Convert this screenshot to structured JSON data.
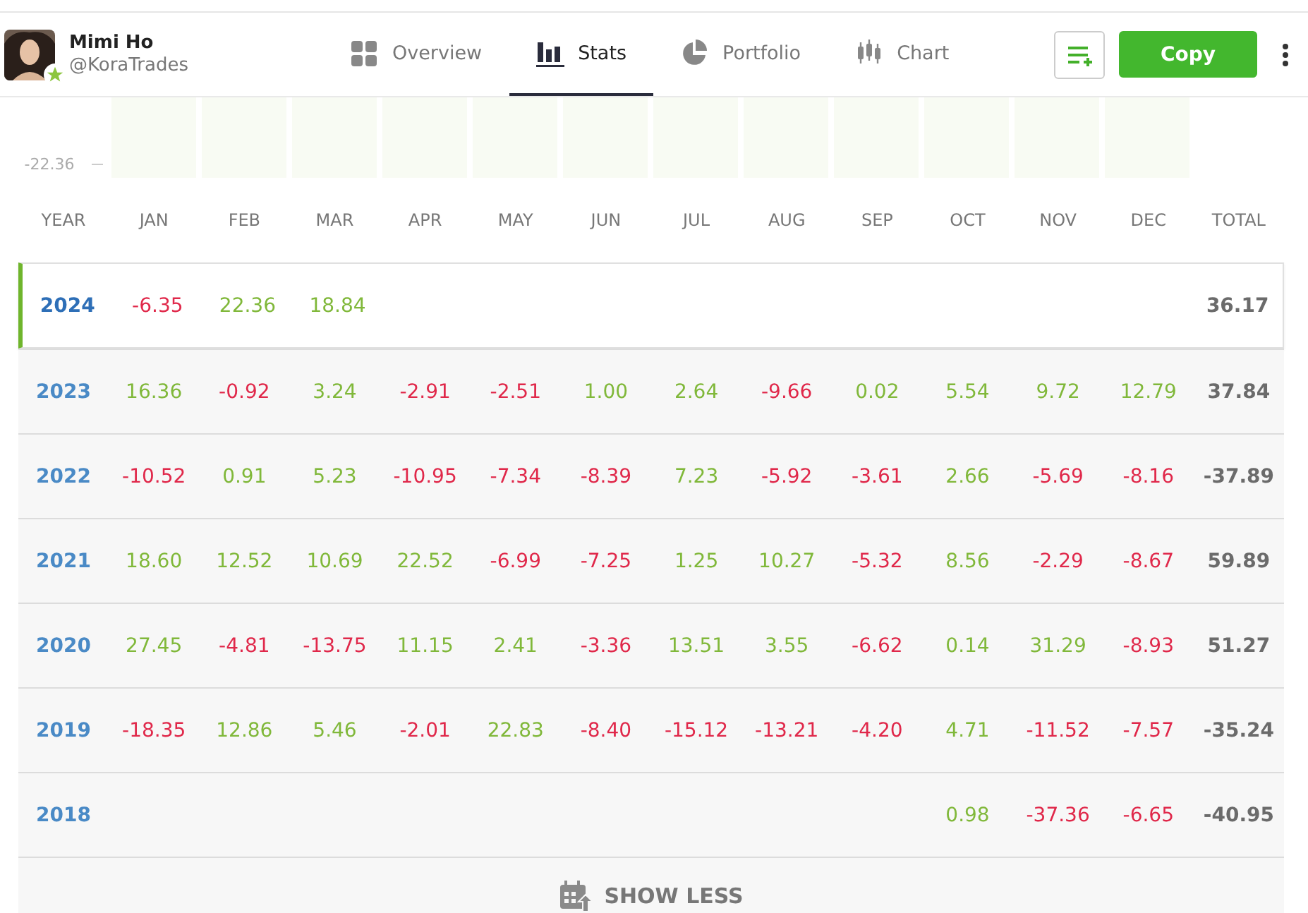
{
  "profile": {
    "name": "Mimi Ho",
    "username": "@KoraTrades"
  },
  "tabs": [
    {
      "label": "Overview",
      "selected": false
    },
    {
      "label": "Stats",
      "selected": true
    },
    {
      "label": "Portfolio",
      "selected": false
    },
    {
      "label": "Chart",
      "selected": false
    }
  ],
  "copy_button": "Copy",
  "chart": {
    "axis_label": "-22.36"
  },
  "table": {
    "columns": [
      "YEAR",
      "JAN",
      "FEB",
      "MAR",
      "APR",
      "MAY",
      "JUN",
      "JUL",
      "AUG",
      "SEP",
      "OCT",
      "NOV",
      "DEC",
      "TOTAL"
    ],
    "rows": [
      {
        "year": "2024",
        "selected": true,
        "total": "36.17",
        "months": [
          {
            "value": "-6.35",
            "kind": "loss"
          },
          {
            "value": "22.36",
            "kind": "gain"
          },
          {
            "value": "18.84",
            "kind": "gain"
          },
          {
            "kind": "blank"
          },
          {
            "kind": "blank"
          },
          {
            "kind": "blank"
          },
          {
            "kind": "blank"
          },
          {
            "kind": "blank"
          },
          {
            "kind": "blank"
          },
          {
            "kind": "blank"
          },
          {
            "kind": "blank"
          },
          {
            "kind": "blank"
          }
        ]
      },
      {
        "year": "2023",
        "selected": false,
        "total": "37.84",
        "months": [
          {
            "value": "16.36",
            "kind": "gain"
          },
          {
            "value": "-0.92",
            "kind": "loss"
          },
          {
            "value": "3.24",
            "kind": "gain"
          },
          {
            "value": "-2.91",
            "kind": "loss"
          },
          {
            "value": "-2.51",
            "kind": "loss"
          },
          {
            "value": "1.00",
            "kind": "gain"
          },
          {
            "value": "2.64",
            "kind": "gain"
          },
          {
            "value": "-9.66",
            "kind": "loss"
          },
          {
            "value": "0.02",
            "kind": "gain"
          },
          {
            "value": "5.54",
            "kind": "gain"
          },
          {
            "value": "9.72",
            "kind": "gain"
          },
          {
            "value": "12.79",
            "kind": "gain"
          }
        ]
      },
      {
        "year": "2022",
        "selected": false,
        "total": "-37.89",
        "months": [
          {
            "value": "-10.52",
            "kind": "loss"
          },
          {
            "value": "0.91",
            "kind": "gain"
          },
          {
            "value": "5.23",
            "kind": "gain"
          },
          {
            "value": "-10.95",
            "kind": "loss"
          },
          {
            "value": "-7.34",
            "kind": "loss"
          },
          {
            "value": "-8.39",
            "kind": "loss"
          },
          {
            "value": "7.23",
            "kind": "gain"
          },
          {
            "value": "-5.92",
            "kind": "loss"
          },
          {
            "value": "-3.61",
            "kind": "loss"
          },
          {
            "value": "2.66",
            "kind": "gain"
          },
          {
            "value": "-5.69",
            "kind": "loss"
          },
          {
            "value": "-8.16",
            "kind": "loss"
          }
        ]
      },
      {
        "year": "2021",
        "selected": false,
        "total": "59.89",
        "months": [
          {
            "value": "18.60",
            "kind": "gain"
          },
          {
            "value": "12.52",
            "kind": "gain"
          },
          {
            "value": "10.69",
            "kind": "gain"
          },
          {
            "value": "22.52",
            "kind": "gain"
          },
          {
            "value": "-6.99",
            "kind": "loss"
          },
          {
            "value": "-7.25",
            "kind": "loss"
          },
          {
            "value": "1.25",
            "kind": "gain"
          },
          {
            "value": "10.27",
            "kind": "gain"
          },
          {
            "value": "-5.32",
            "kind": "loss"
          },
          {
            "value": "8.56",
            "kind": "gain"
          },
          {
            "value": "-2.29",
            "kind": "loss"
          },
          {
            "value": "-8.67",
            "kind": "loss"
          }
        ]
      },
      {
        "year": "2020",
        "selected": false,
        "total": "51.27",
        "months": [
          {
            "value": "27.45",
            "kind": "gain"
          },
          {
            "value": "-4.81",
            "kind": "loss"
          },
          {
            "value": "-13.75",
            "kind": "loss"
          },
          {
            "value": "11.15",
            "kind": "gain"
          },
          {
            "value": "2.41",
            "kind": "gain"
          },
          {
            "value": "-3.36",
            "kind": "loss"
          },
          {
            "value": "13.51",
            "kind": "gain"
          },
          {
            "value": "3.55",
            "kind": "gain"
          },
          {
            "value": "-6.62",
            "kind": "loss"
          },
          {
            "value": "0.14",
            "kind": "gain"
          },
          {
            "value": "31.29",
            "kind": "gain"
          },
          {
            "value": "-8.93",
            "kind": "loss"
          }
        ]
      },
      {
        "year": "2019",
        "selected": false,
        "total": "-35.24",
        "months": [
          {
            "value": "-18.35",
            "kind": "loss"
          },
          {
            "value": "12.86",
            "kind": "gain"
          },
          {
            "value": "5.46",
            "kind": "gain"
          },
          {
            "value": "-2.01",
            "kind": "loss"
          },
          {
            "value": "22.83",
            "kind": "gain"
          },
          {
            "value": "-8.40",
            "kind": "loss"
          },
          {
            "value": "-15.12",
            "kind": "loss"
          },
          {
            "value": "-13.21",
            "kind": "loss"
          },
          {
            "value": "-4.20",
            "kind": "loss"
          },
          {
            "value": "4.71",
            "kind": "gain"
          },
          {
            "value": "-11.52",
            "kind": "loss"
          },
          {
            "value": "-7.57",
            "kind": "loss"
          }
        ]
      },
      {
        "year": "2018",
        "selected": false,
        "total": "-40.95",
        "months": [
          {
            "kind": "blank"
          },
          {
            "kind": "blank"
          },
          {
            "kind": "blank"
          },
          {
            "kind": "blank"
          },
          {
            "kind": "blank"
          },
          {
            "kind": "blank"
          },
          {
            "kind": "blank"
          },
          {
            "kind": "blank"
          },
          {
            "kind": "blank"
          },
          {
            "value": "0.98",
            "kind": "gain"
          },
          {
            "value": "-37.36",
            "kind": "loss"
          },
          {
            "value": "-6.65",
            "kind": "loss"
          }
        ]
      }
    ]
  },
  "show_less_button": "SHOW LESS"
}
